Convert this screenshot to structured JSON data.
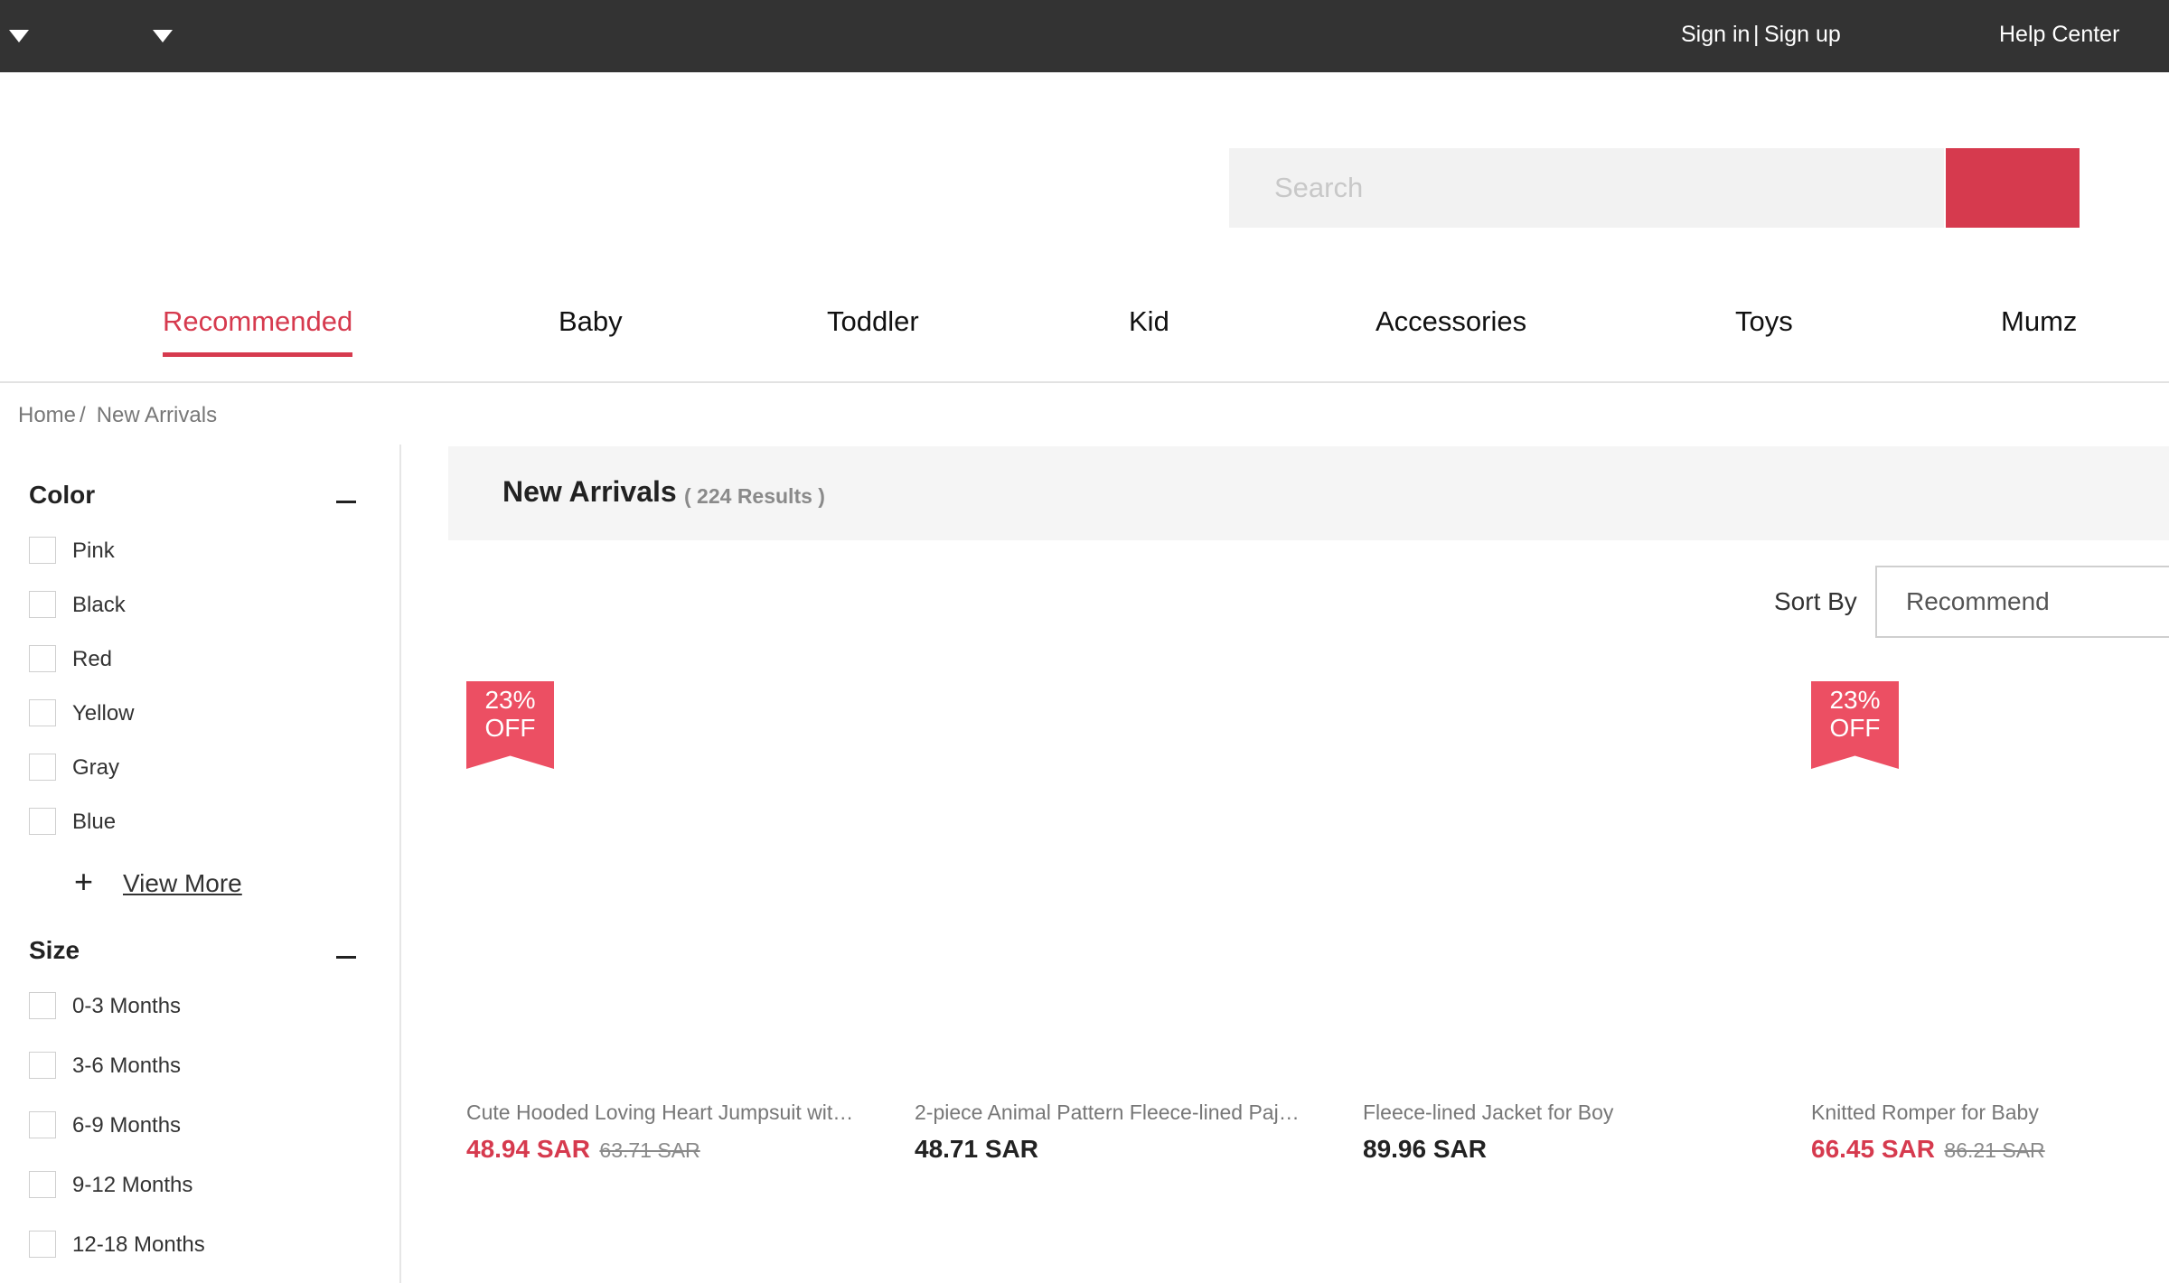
{
  "topbar": {
    "signin_link": "Sign in",
    "divider": "|",
    "signup_link": "Sign up",
    "help_center": "Help Center"
  },
  "search": {
    "placeholder": "Search"
  },
  "nav": {
    "items": [
      "Recommended",
      "Baby",
      "Toddler",
      "Kid",
      "Accessories",
      "Toys",
      "Mumz"
    ],
    "active": "Recommended"
  },
  "breadcrumb": {
    "home": "Home",
    "separator": "/",
    "current": "New Arrivals"
  },
  "filters": {
    "color": {
      "title": "Color",
      "options": [
        "Pink",
        "Black",
        "Red",
        "Yellow",
        "Gray",
        "Blue"
      ],
      "view_more": "View More"
    },
    "size": {
      "title": "Size",
      "options": [
        "0-3 Months",
        "3-6 Months",
        "6-9 Months",
        "9-12 Months",
        "12-18 Months"
      ]
    }
  },
  "results": {
    "title": "New Arrivals",
    "count": "( 224 Results )"
  },
  "sort": {
    "label": "Sort By",
    "selected": "Recommend"
  },
  "products": [
    {
      "name": "Cute Hooded Loving Heart Jumpsuit wit…",
      "price": "48.94 SAR",
      "old_price": "63.71 SAR",
      "badge_pct": "23%",
      "badge_off": "OFF"
    },
    {
      "name": "2-piece Animal Pattern Fleece-lined Paj…",
      "price": "48.71 SAR",
      "old_price": "",
      "badge_pct": "",
      "badge_off": ""
    },
    {
      "name": "Fleece-lined Jacket for Boy",
      "price": "89.96 SAR",
      "old_price": "",
      "badge_pct": "",
      "badge_off": ""
    },
    {
      "name": "Knitted Romper for Baby",
      "price": "66.45 SAR",
      "old_price": "86.21 SAR",
      "badge_pct": "23%",
      "badge_off": "OFF"
    }
  ],
  "colors": {
    "accent": "#d63a4e",
    "badge": "#ec4f63",
    "topbar": "#333333"
  }
}
